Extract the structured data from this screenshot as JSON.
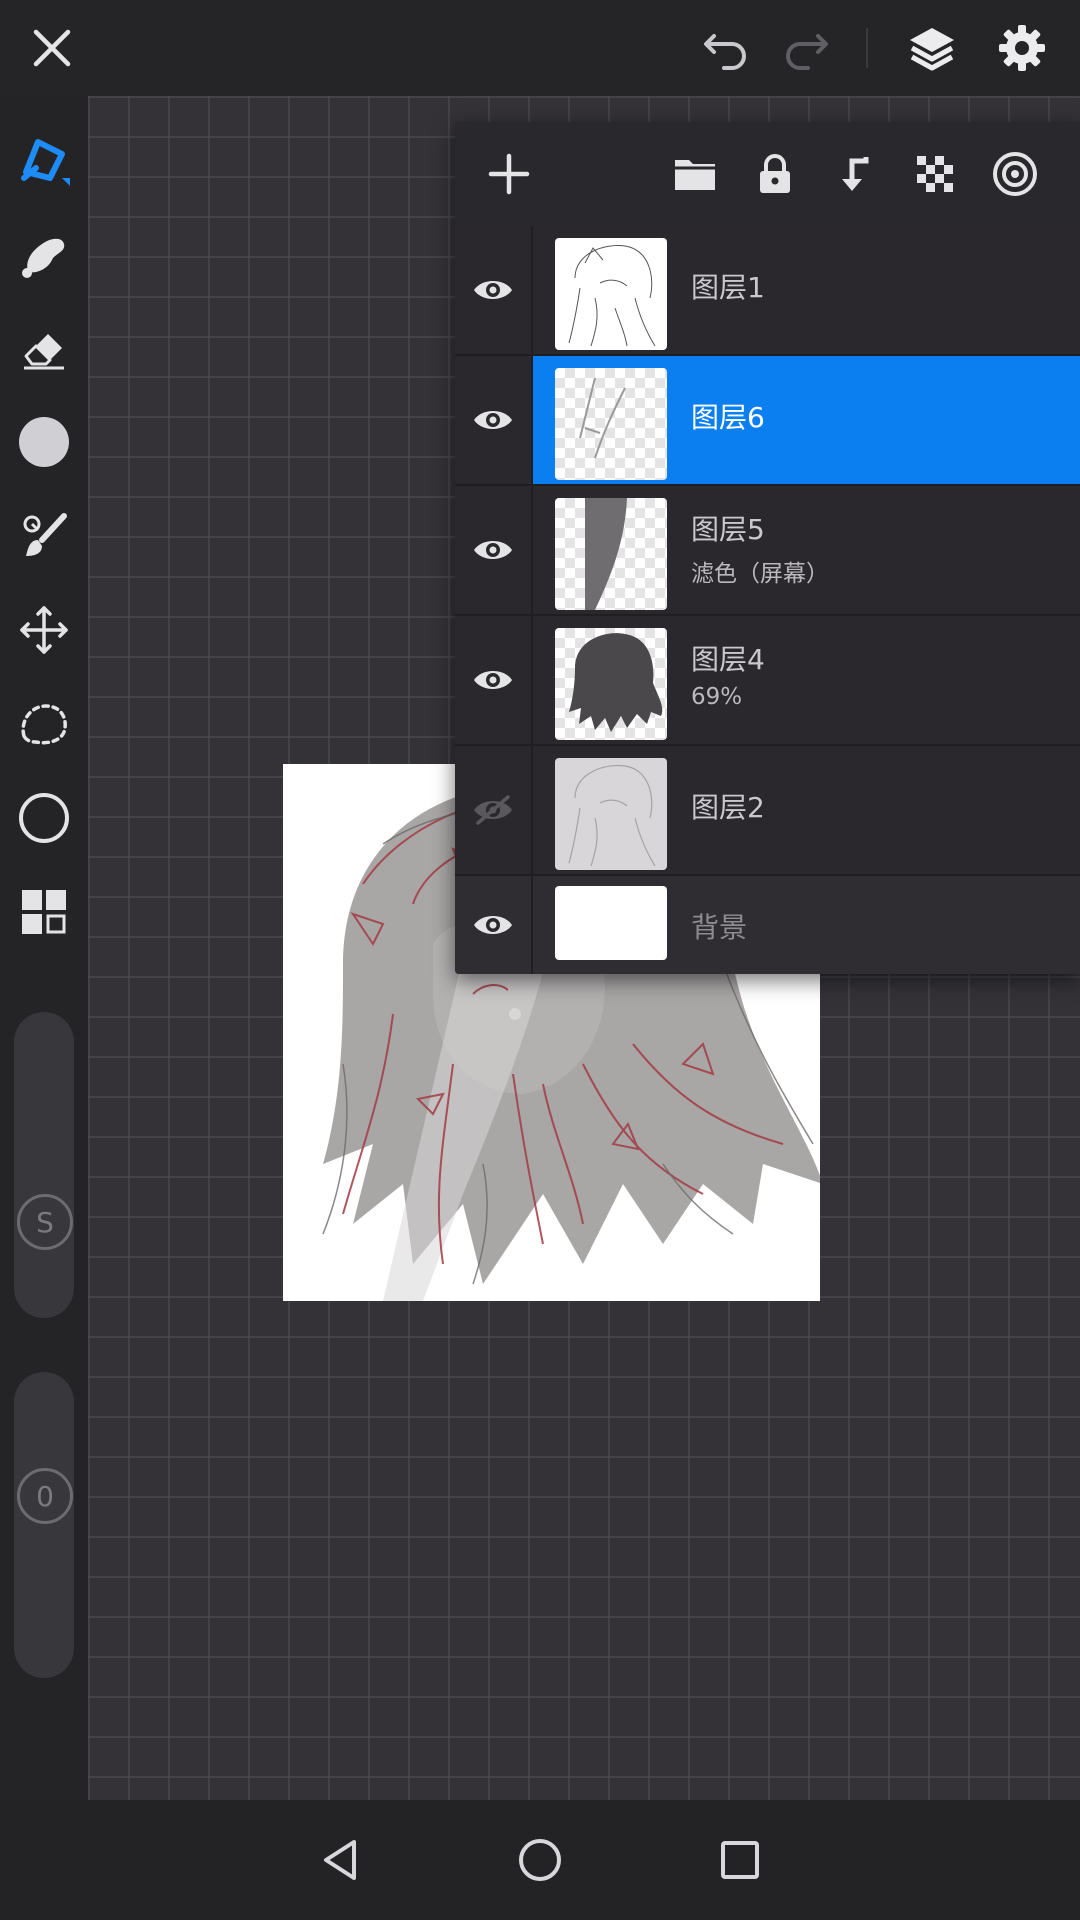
{
  "topbar": {
    "icons": [
      "close-icon",
      "undo-icon",
      "redo-icon",
      "layers-icon",
      "settings-icon"
    ]
  },
  "tools": [
    "pen-icon",
    "smudge-icon",
    "eraser-icon",
    "fill-icon",
    "brush-icon",
    "transform-icon",
    "lasso-icon",
    "shape-icon",
    "grid-icon"
  ],
  "sliders": {
    "size_label": "S",
    "opacity_label": "0"
  },
  "layers_toolbar": {
    "icons": [
      "add-icon",
      "folder-icon",
      "lock-icon",
      "merge-down-icon",
      "transparency-icon",
      "layer-effect-icon"
    ]
  },
  "layers": [
    {
      "name": "图层1",
      "sub": "",
      "visible": true,
      "selected": false
    },
    {
      "name": "图层6",
      "sub": "",
      "visible": true,
      "selected": true
    },
    {
      "name": "图层5",
      "sub": "滤色（屏幕）",
      "visible": true,
      "selected": false
    },
    {
      "name": "图层4",
      "sub": "69%",
      "visible": true,
      "selected": false
    },
    {
      "name": "图层2",
      "sub": "",
      "visible": false,
      "selected": false
    },
    {
      "name": "背景",
      "sub": "",
      "visible": true,
      "selected": false
    }
  ],
  "navbar": {
    "icons": [
      "back-icon",
      "home-icon",
      "recents-icon"
    ]
  },
  "colors": {
    "accent": "#0b7ef0",
    "panel": "#2a282c",
    "toolbar": "#242427"
  }
}
